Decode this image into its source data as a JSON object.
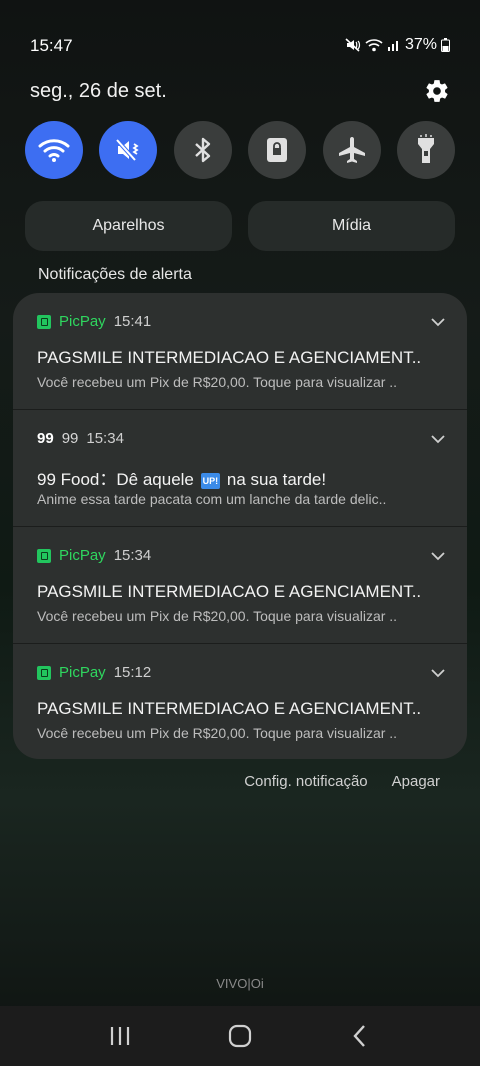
{
  "status_bar": {
    "time": "15:47",
    "battery_percent": "37%",
    "icons": [
      "mute-icon",
      "wifi-icon",
      "signal-icon",
      "battery-icon"
    ]
  },
  "header": {
    "date": "seg., 26 de set."
  },
  "quick_settings": [
    {
      "name": "wifi",
      "icon": "wifi-icon",
      "active": true
    },
    {
      "name": "sound",
      "icon": "mute-vibrate-icon",
      "active": true
    },
    {
      "name": "bluetooth",
      "icon": "bluetooth-icon",
      "active": false
    },
    {
      "name": "portrait-lock",
      "icon": "lock-rotation-icon",
      "active": false
    },
    {
      "name": "airplane",
      "icon": "airplane-icon",
      "active": false
    },
    {
      "name": "flashlight",
      "icon": "flashlight-icon",
      "active": false
    }
  ],
  "pills": {
    "devices": "Aparelhos",
    "media": "Mídia"
  },
  "section_label": "Notificações de alerta",
  "notifications": [
    {
      "app": "PicPay",
      "time": "15:41",
      "title": "PAGSMILE INTERMEDIACAO E AGENCIAMENT..",
      "body": "Você recebeu um Pix de R$20,00. Toque para visualizar .."
    },
    {
      "app": "99",
      "time": "15:34",
      "title_prefix": "99 Food：Dê aquele",
      "badge": "UP!",
      "title_suffix": "na sua tarde!",
      "body": "Anime essa tarde pacata com um lanche da tarde delic.."
    },
    {
      "app": "PicPay",
      "time": "15:34",
      "title": "PAGSMILE INTERMEDIACAO E AGENCIAMENT..",
      "body": "Você recebeu um Pix de R$20,00. Toque para visualizar .."
    },
    {
      "app": "PicPay",
      "time": "15:12",
      "title": "PAGSMILE INTERMEDIACAO E AGENCIAMENT..",
      "body": "Você recebeu um Pix de R$20,00. Toque para visualizar .."
    }
  ],
  "actions": {
    "settings": "Config. notificação",
    "clear": "Apagar"
  },
  "carrier": "VIVO|Oi",
  "colors": {
    "accent": "#3d6ef2",
    "picpay": "#2fd65f",
    "panel": "#2d302f"
  }
}
